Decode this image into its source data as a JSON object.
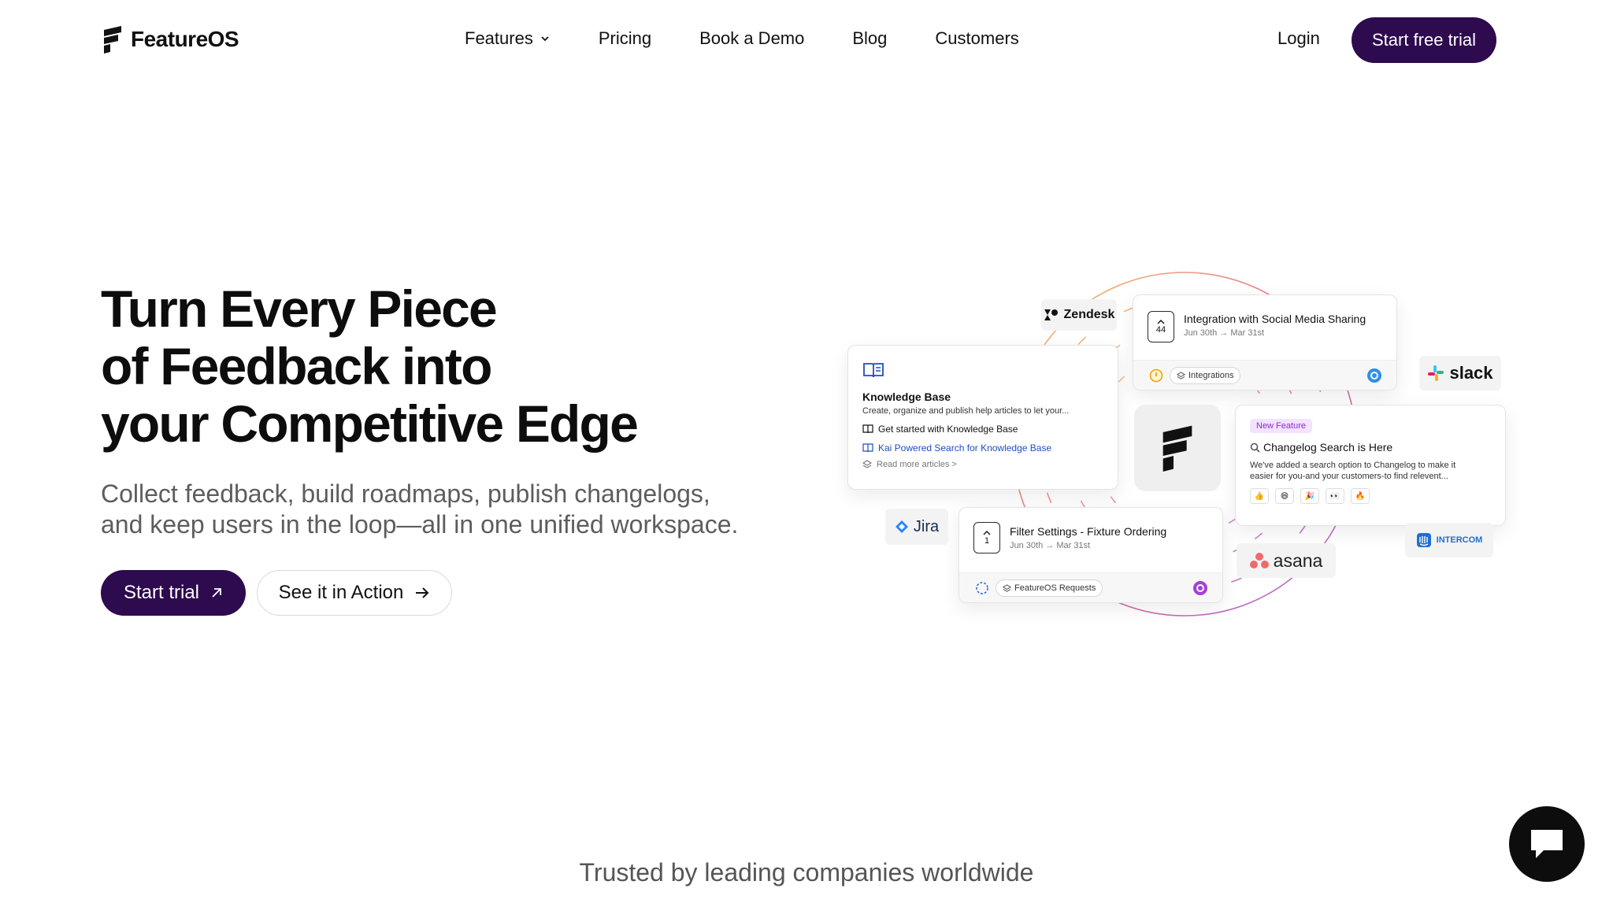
{
  "brand": {
    "name": "FeatureOS"
  },
  "nav": {
    "items": [
      {
        "label": "Features",
        "has_dropdown": true
      },
      {
        "label": "Pricing"
      },
      {
        "label": "Book a Demo"
      },
      {
        "label": "Blog"
      },
      {
        "label": "Customers"
      }
    ],
    "login": "Login",
    "cta": "Start free trial"
  },
  "hero": {
    "title_lines": [
      "Turn Every Piece",
      "of Feedback into",
      "your Competitive Edge"
    ],
    "subtitle_lines": [
      "Collect feedback, build roadmaps, publish changelogs,",
      "and keep users in the loop—all in one unified workspace."
    ],
    "primary_button": "Start trial",
    "secondary_button": "See it in Action"
  },
  "illustration": {
    "knowledge_base": {
      "title": "Knowledge Base",
      "description": "Create, organize and publish help articles to let your...",
      "link1": "Get started with Knowledge Base",
      "link2": "Kai Powered Search for Knowledge Base",
      "more": "Read more articles >"
    },
    "social_card": {
      "votes": "44",
      "title": "Integration with Social Media Sharing",
      "date": "Jun 30th → Mar 31st",
      "tag": "Integrations"
    },
    "changelog_card": {
      "badge": "New Feature",
      "title": "Changelog Search is Here",
      "desc_line1": "We've added a search option to Changelog to make it",
      "desc_line2": "easier for you-and your customers-to find relevent...",
      "reactions": [
        "👍",
        "😄",
        "🎉",
        "👀",
        "🔥"
      ]
    },
    "filter_card": {
      "votes": "1",
      "title": "Filter Settings - Fixture Ordering",
      "date": "Jun 30th → Mar 31st",
      "tag": "FeatureOS Requests"
    },
    "integrations": {
      "zendesk": "Zendesk",
      "slack": "slack",
      "jira": "Jira",
      "asana": "asana",
      "intercom": "INTERCOM"
    }
  },
  "trusted_text": "Trusted by leading companies worldwide",
  "colors": {
    "brand_purple": "#2e0a4f",
    "link_blue": "#1f4fbf",
    "badge_purple": "#8a2bd3"
  }
}
